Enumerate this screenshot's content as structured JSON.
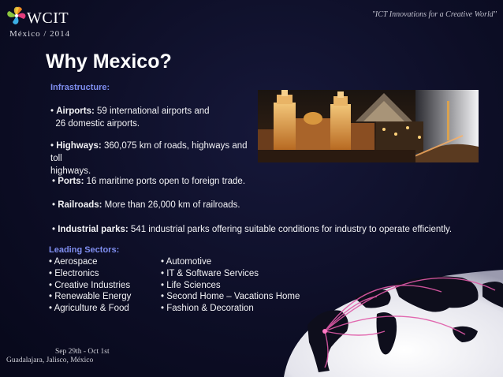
{
  "header": {
    "logo_word": "WCIT",
    "logo_sub": "México / 2014",
    "tagline": "\"ICT Innovations for a Creative World\""
  },
  "title": "Why Mexico?",
  "infrastructure": {
    "heading": "Infrastructure:",
    "items": [
      {
        "label": "Airports:",
        "text": " 59 international airports and",
        "text2": "26 domestic airports."
      },
      {
        "label": "Highways:",
        "text": " 360,075 km of roads, highways  and toll",
        "text2": "highways."
      },
      {
        "label": "Ports:",
        "text": " 16 maritime ports open to foreign trade."
      },
      {
        "label": "Railroads:",
        "text": " More than 26,000 km of railroads."
      },
      {
        "label": "Industrial parks:",
        "text": " 541 industrial parks offering  suitable conditions for industry to operate efficiently."
      }
    ]
  },
  "sectors": {
    "heading": "Leading Sectors:",
    "left": [
      "• Aerospace",
      "• Electronics",
      "• Creative Industries",
      "• Renewable Energy",
      "• Agriculture & Food"
    ],
    "right": [
      "• Automotive",
      "• IT & Software Services",
      "• Life Sciences",
      "• Second Home – Vacations Home",
      "• Fashion & Decoration"
    ]
  },
  "footer": {
    "dates": "Sep 29th - Oct 1st",
    "location": "Guadalajara, Jalisco, México"
  },
  "colors": {
    "background": "#0d0e26",
    "heading_accent": "#7f8ef0",
    "text": "#f2f2f5",
    "route_lines": "#e05aa8"
  }
}
